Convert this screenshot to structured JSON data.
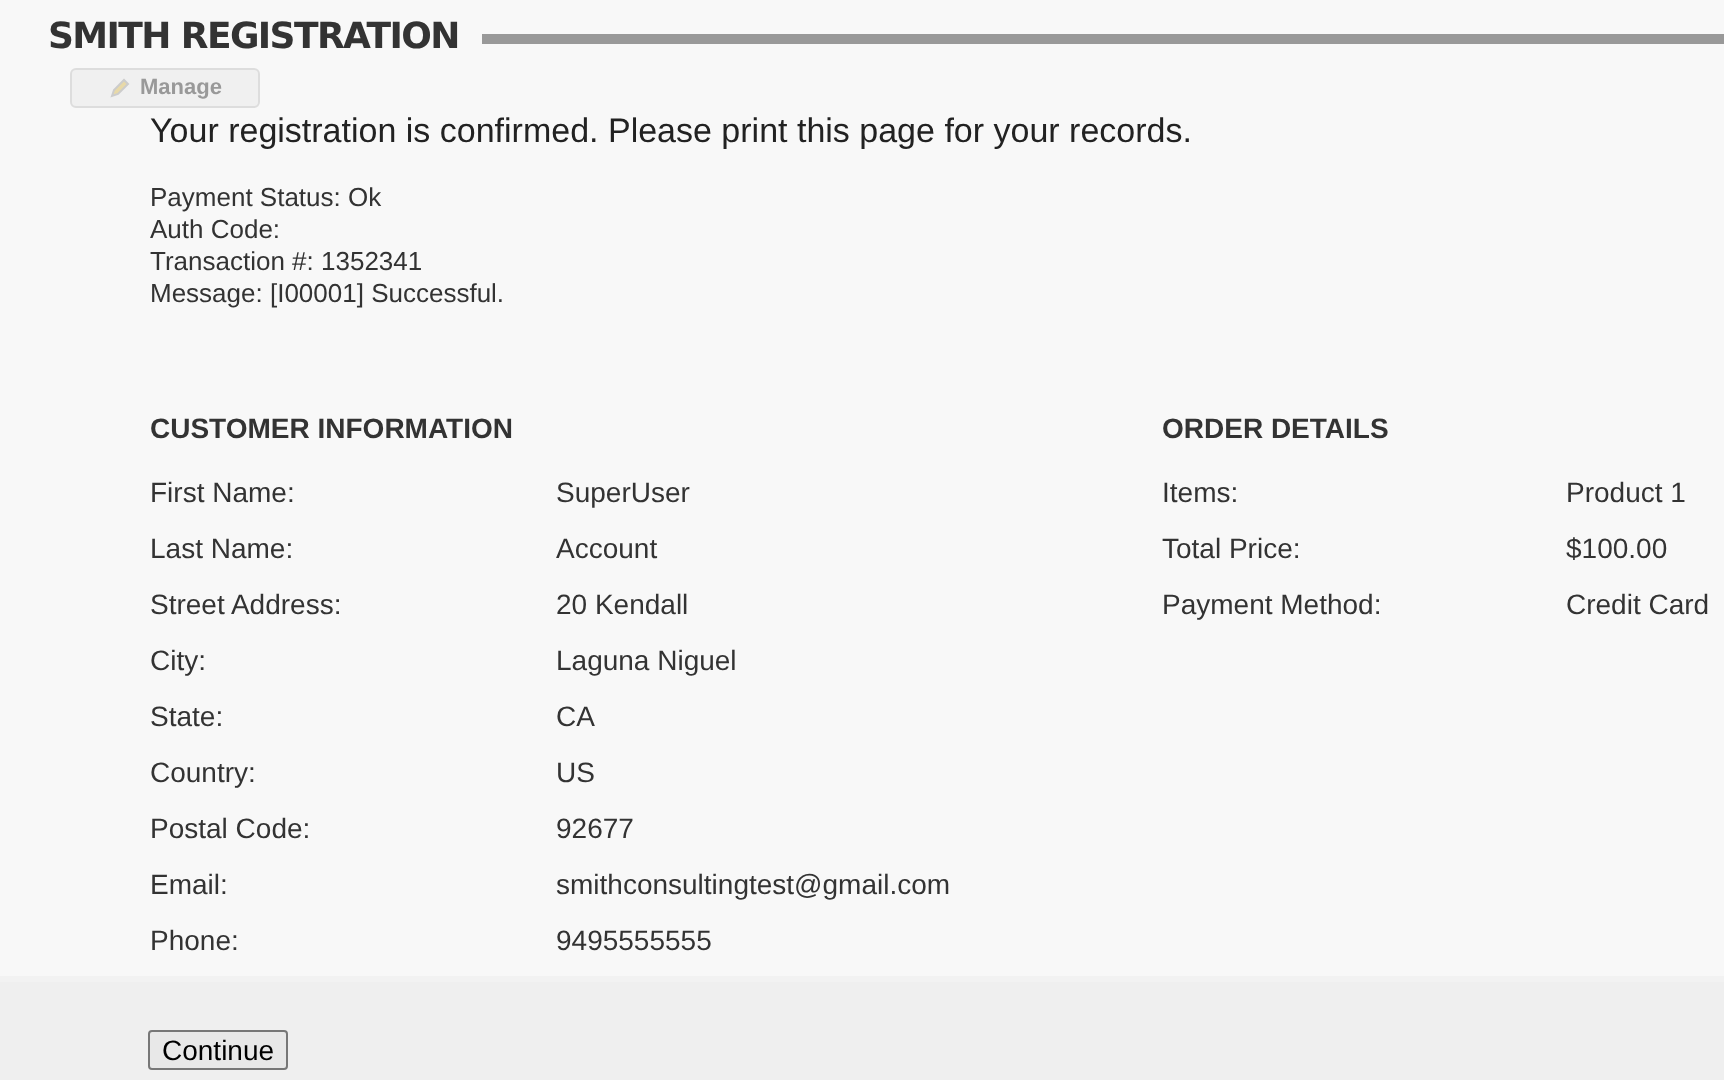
{
  "header": {
    "title": "SMITH REGISTRATION",
    "manage_button": "Manage"
  },
  "confirmation": "Your registration is confirmed. Please print this page for your records.",
  "payment_lines": [
    "Payment Status: Ok",
    "Auth Code:",
    "Transaction #: 1352341",
    "Message: [I00001] Successful."
  ],
  "customer": {
    "heading": "CUSTOMER INFORMATION",
    "rows": [
      {
        "label": "First Name:",
        "value": "SuperUser"
      },
      {
        "label": "Last Name:",
        "value": "Account"
      },
      {
        "label": "Street Address:",
        "value": "20 Kendall"
      },
      {
        "label": "City:",
        "value": "Laguna Niguel"
      },
      {
        "label": "State:",
        "value": "CA"
      },
      {
        "label": "Country:",
        "value": "US"
      },
      {
        "label": "Postal Code:",
        "value": "92677"
      },
      {
        "label": "Email:",
        "value": "smithconsultingtest@gmail.com"
      },
      {
        "label": "Phone:",
        "value": "9495555555"
      }
    ]
  },
  "order": {
    "heading": "ORDER DETAILS",
    "rows": [
      {
        "label": "Items:",
        "value": "Product 1"
      },
      {
        "label": "Total Price:",
        "value": "$100.00"
      },
      {
        "label": "Payment Method:",
        "value": "Credit Card"
      }
    ]
  },
  "footer": {
    "continue_button": "Continue"
  }
}
